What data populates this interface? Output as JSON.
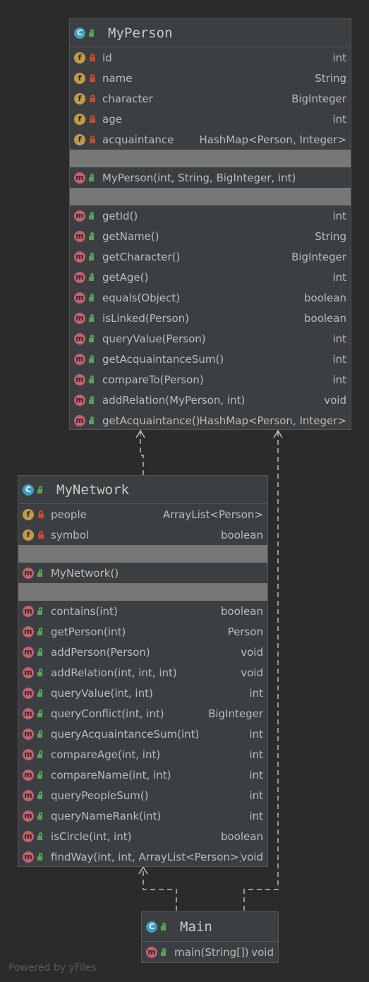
{
  "classes": {
    "myperson": {
      "name": "MyPerson",
      "fields": [
        {
          "name": "id",
          "type": "int"
        },
        {
          "name": "name",
          "type": "String"
        },
        {
          "name": "character",
          "type": "BigInteger"
        },
        {
          "name": "age",
          "type": "int"
        },
        {
          "name": "acquaintance",
          "type": "HashMap<Person, Integer>"
        }
      ],
      "constructors": [
        {
          "name": "MyPerson(int, String, BigInteger, int)",
          "type": ""
        }
      ],
      "methods": [
        {
          "name": "getId()",
          "type": "int"
        },
        {
          "name": "getName()",
          "type": "String"
        },
        {
          "name": "getCharacter()",
          "type": "BigInteger"
        },
        {
          "name": "getAge()",
          "type": "int"
        },
        {
          "name": "equals(Object)",
          "type": "boolean"
        },
        {
          "name": "isLinked(Person)",
          "type": "boolean"
        },
        {
          "name": "queryValue(Person)",
          "type": "int"
        },
        {
          "name": "getAcquaintanceSum()",
          "type": "int"
        },
        {
          "name": "compareTo(Person)",
          "type": "int"
        },
        {
          "name": "addRelation(MyPerson, int)",
          "type": "void"
        },
        {
          "name": "getAcquaintance()",
          "type": "HashMap<Person, Integer>"
        }
      ]
    },
    "mynetwork": {
      "name": "MyNetwork",
      "fields": [
        {
          "name": "people",
          "type": "ArrayList<Person>"
        },
        {
          "name": "symbol",
          "type": "boolean"
        }
      ],
      "constructors": [
        {
          "name": "MyNetwork()",
          "type": ""
        }
      ],
      "methods": [
        {
          "name": "contains(int)",
          "type": "boolean"
        },
        {
          "name": "getPerson(int)",
          "type": "Person"
        },
        {
          "name": "addPerson(Person)",
          "type": "void"
        },
        {
          "name": "addRelation(int, int, int)",
          "type": "void"
        },
        {
          "name": "queryValue(int, int)",
          "type": "int"
        },
        {
          "name": "queryConflict(int, int)",
          "type": "BigInteger"
        },
        {
          "name": "queryAcquaintanceSum(int)",
          "type": "int"
        },
        {
          "name": "compareAge(int, int)",
          "type": "int"
        },
        {
          "name": "compareName(int, int)",
          "type": "int"
        },
        {
          "name": "queryPeopleSum()",
          "type": "int"
        },
        {
          "name": "queryNameRank(int)",
          "type": "int"
        },
        {
          "name": "isCircle(int, int)",
          "type": "boolean"
        },
        {
          "name": "findWay(int, int, ArrayList<Person>)",
          "type": "void"
        }
      ]
    },
    "main": {
      "name": "Main",
      "fields": [],
      "constructors": [],
      "methods": [
        {
          "name": "main(String[])",
          "type": "void"
        }
      ]
    }
  },
  "icons": {
    "class": "C",
    "field": "f",
    "method": "m"
  },
  "colors": {
    "background": "#2b2b2b",
    "panel": "#3c3f41",
    "separator": "#777777",
    "field_icon": "#c19a4a",
    "method_icon": "#c4606f",
    "class_icon": "#3f9dbf",
    "public": "#5aa05a",
    "private": "#c8492c"
  },
  "footer": "Powered by yFiles"
}
